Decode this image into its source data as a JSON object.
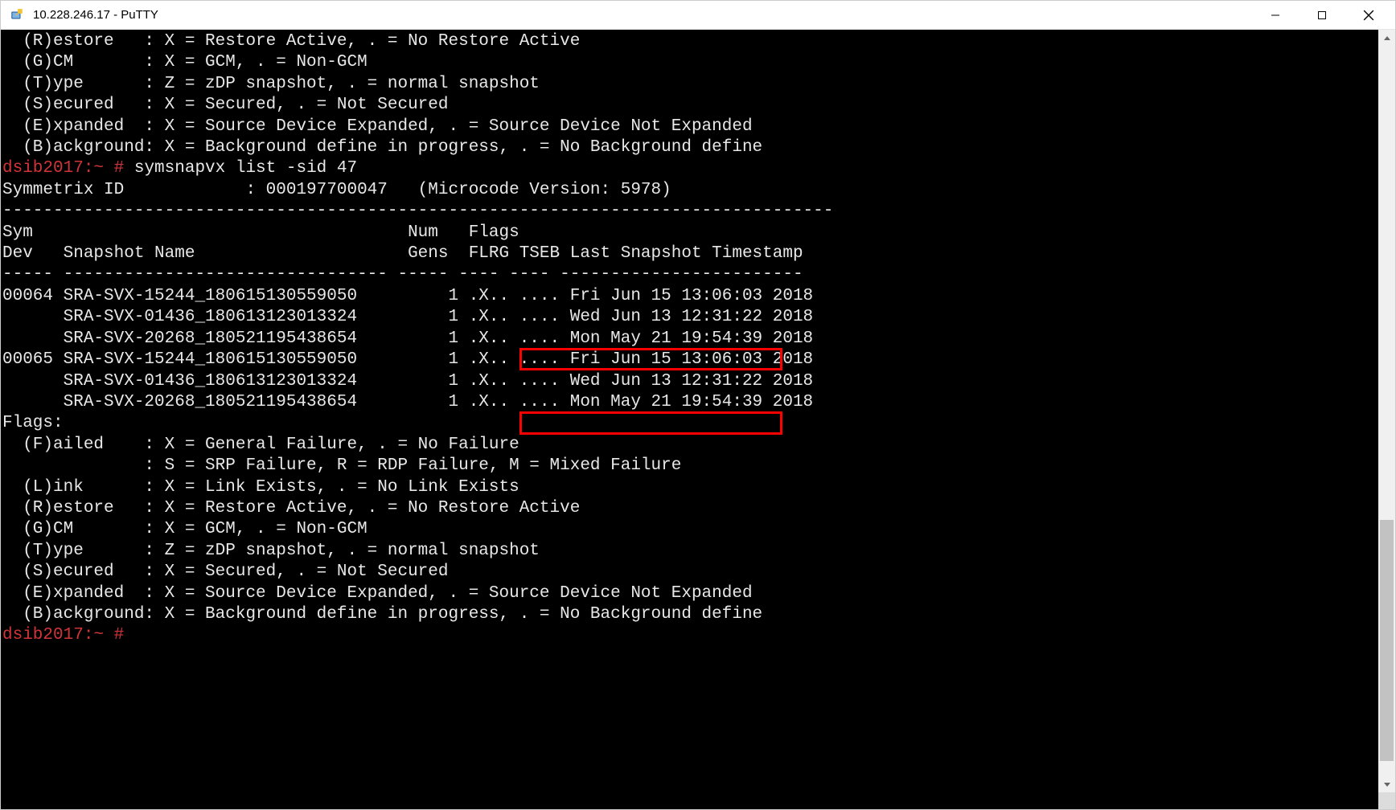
{
  "window": {
    "title": "10.228.246.17 - PuTTY"
  },
  "colors": {
    "prompt": "#d13438",
    "terminal_bg": "#000000",
    "terminal_fg": "#e8e8e8"
  },
  "legend_top": [
    "  (R)estore   : X = Restore Active, . = No Restore Active",
    "  (G)CM       : X = GCM, . = Non-GCM",
    "  (T)ype      : Z = zDP snapshot, . = normal snapshot",
    "  (S)ecured   : X = Secured, . = Not Secured",
    "  (E)xpanded  : X = Source Device Expanded, . = Source Device Not Expanded",
    "  (B)ackground: X = Background define in progress, . = No Background define"
  ],
  "prompt1": {
    "host": "dsib2017:~ #",
    "cmd": " symsnapvx list -sid 47"
  },
  "symmetrix_line": "Symmetrix ID            : 000197700047   (Microcode Version: 5978)",
  "divider1": "----------------------------------------------------------------------------------",
  "header1": "Sym                                     Num   Flags",
  "header2": "Dev   Snapshot Name                     Gens  FLRG TSEB Last Snapshot Timestamp",
  "divider2": "----- -------------------------------- ----- ---- ---- ------------------------",
  "table": [
    {
      "dev": "00064",
      "name": "SRA-SVX-15244_180615130559050",
      "gens": "1",
      "flrg": ".X..",
      "tseb": "....",
      "ts": "Fri Jun 15 13:06:03 2018",
      "highlight": true
    },
    {
      "dev": "     ",
      "name": "SRA-SVX-01436_180613123013324",
      "gens": "1",
      "flrg": ".X..",
      "tseb": "....",
      "ts": "Wed Jun 13 12:31:22 2018",
      "highlight": false
    },
    {
      "dev": "     ",
      "name": "SRA-SVX-20268_180521195438654",
      "gens": "1",
      "flrg": ".X..",
      "tseb": "....",
      "ts": "Mon May 21 19:54:39 2018",
      "highlight": false
    },
    {
      "dev": "00065",
      "name": "SRA-SVX-15244_180615130559050",
      "gens": "1",
      "flrg": ".X..",
      "tseb": "....",
      "ts": "Fri Jun 15 13:06:03 2018",
      "highlight": true
    },
    {
      "dev": "     ",
      "name": "SRA-SVX-01436_180613123013324",
      "gens": "1",
      "flrg": ".X..",
      "tseb": "....",
      "ts": "Wed Jun 13 12:31:22 2018",
      "highlight": false
    },
    {
      "dev": "     ",
      "name": "SRA-SVX-20268_180521195438654",
      "gens": "1",
      "flrg": ".X..",
      "tseb": "....",
      "ts": "Mon May 21 19:54:39 2018",
      "highlight": false
    }
  ],
  "flags_label": "Flags:",
  "legend_bottom": [
    "  (F)ailed    : X = General Failure, . = No Failure",
    "              : S = SRP Failure, R = RDP Failure, M = Mixed Failure",
    "  (L)ink      : X = Link Exists, . = No Link Exists",
    "  (R)estore   : X = Restore Active, . = No Restore Active",
    "  (G)CM       : X = GCM, . = Non-GCM",
    "  (T)ype      : Z = zDP snapshot, . = normal snapshot",
    "  (S)ecured   : X = Secured, . = Not Secured",
    "  (E)xpanded  : X = Source Device Expanded, . = Source Device Not Expanded",
    "  (B)ackground: X = Background define in progress, . = No Background define"
  ],
  "prompt2": {
    "host": "dsib2017:~ #",
    "cmd": ""
  }
}
